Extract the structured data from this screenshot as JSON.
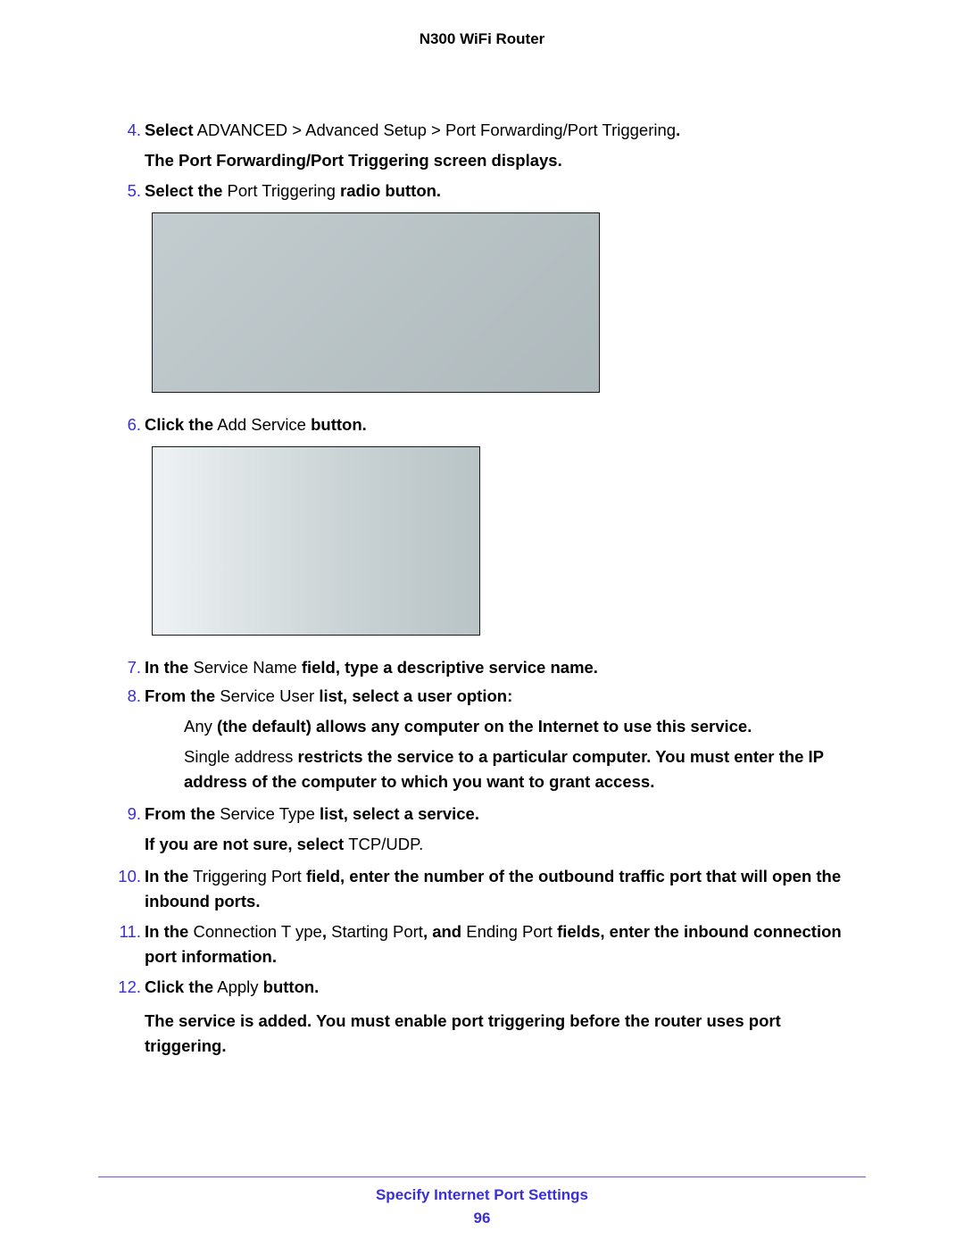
{
  "header": "N300 WiFi Router",
  "footer": {
    "section": "Specify Internet Port Settings",
    "page": "96"
  },
  "steps": {
    "s4": {
      "num": "4.",
      "bold1": "Select",
      "plain1": " ADVANCED > Advanced Setup > Port Forwarding/Port Triggering",
      "bold2": ".",
      "line2": "The Port Forwarding/Port Triggering screen displays."
    },
    "s5": {
      "num": "5.",
      "bold1": "Select the",
      "plain1": " Port Triggering ",
      "bold2": "radio button."
    },
    "s6": {
      "num": "6.",
      "bold1": "Click the",
      "plain1": " Add Service ",
      "bold2": "button."
    },
    "s7": {
      "num": "7.",
      "bold1": "In the ",
      "plain1": "Service Name ",
      "bold2": "field, type a descriptive service name."
    },
    "s8": {
      "num": "8.",
      "bold1": "From the ",
      "plain1": "Service User ",
      "bold2": "list, select a user option:",
      "bullet1_plain": "Any",
      "bullet1_bold": " (the default) allows any computer on the Internet to use this service.",
      "bullet2_plain1": "Single address",
      "bullet2_bold1": " restricts the service to a particular computer.",
      "bullet2_bold2": " You must enter the IP address of the computer to which you want to grant access."
    },
    "s9": {
      "num": "9.",
      "bold1": "From the ",
      "plain1": "Service Type ",
      "bold2": "list, select a service.",
      "line2_bold": "If you are not sure, select ",
      "line2_plain": "TCP/UDP."
    },
    "s10": {
      "num": "10.",
      "bold1": "In the",
      "plain1": " Triggering Port  ",
      "bold2": " field, enter the number of the outbound traffic port that will open the inbound ports."
    },
    "s11": {
      "num": "11.",
      "bold1": "In the ",
      "plain1": "Connection T ype",
      "bold2": ", ",
      "plain2": "Starting Port",
      "bold3": ", and  ",
      "plain3": "Ending Port  ",
      "bold4": "fields, enter the inbound connection port information."
    },
    "s12": {
      "num": "12.",
      "bold1": "Click the",
      "plain1": " Apply ",
      "bold2": "button.",
      "line2": "The service is added. You must enable port triggering before the router uses port triggering."
    }
  }
}
